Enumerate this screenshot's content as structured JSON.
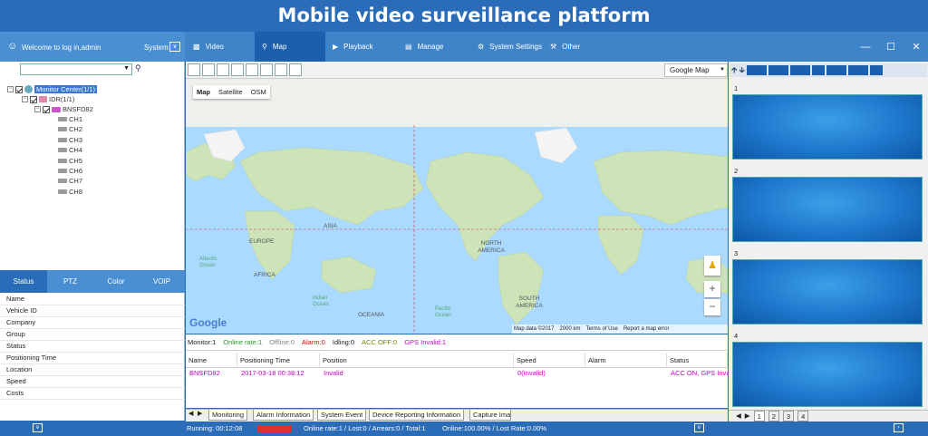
{
  "app": {
    "title": "Mobile video surveillance platform"
  },
  "user": {
    "welcome": "Welcome to log in,admin",
    "system_label": "System"
  },
  "nav": [
    {
      "label": "Video",
      "icon": "video-icon"
    },
    {
      "label": "Map",
      "icon": "map-pin-icon"
    },
    {
      "label": "Playback",
      "icon": "playback-icon"
    },
    {
      "label": "Manage",
      "icon": "document-icon"
    },
    {
      "label": "System Settings",
      "icon": "gear-icon"
    },
    {
      "label": "Other",
      "icon": "wrench-icon"
    }
  ],
  "search": {
    "value": ""
  },
  "tree": {
    "root": "Monitor Center(1/1)",
    "group": "IDR(1/1)",
    "device": "BNSFD82",
    "channels": [
      "CH1",
      "CH2",
      "CH3",
      "CH4",
      "CH5",
      "CH6",
      "CH7",
      "CH8"
    ]
  },
  "status_tabs": [
    "Status",
    "PTZ",
    "Color",
    "VOIP"
  ],
  "info_fields": [
    "Name",
    "Vehicle ID",
    "Company",
    "Group",
    "Status",
    "Positioning Time",
    "Location",
    "Speed",
    "Costs"
  ],
  "map": {
    "provider": "Google Map",
    "types": [
      "Map",
      "Satellite",
      "OSM"
    ],
    "labels": {
      "asia": "ASIA",
      "europe": "EUROPE",
      "africa": "AFRICA",
      "north_america": "NORTH AMERICA",
      "south_america": "SOUTH AMERICA",
      "oceania": "OCEANIA",
      "indian_ocean": "Indian Ocean",
      "pacific_ocean": "Pacific Ocean",
      "atlantic_ocean": "Atlantic Ocean"
    },
    "footer": {
      "logo": "Google",
      "data": "Map data ©2017",
      "scale": "2000 km",
      "terms": "Terms of Use",
      "report": "Report a map error"
    },
    "zoom_in": "+",
    "zoom_out": "−"
  },
  "monitor": {
    "monitor": "Monitor:1",
    "online": "Online rate:1",
    "offline": "Offline:0",
    "alarm": "Alarm:0",
    "idling": "Idling:0",
    "acc_off": "ACC OFF:0",
    "gps_invalid": "GPS Invalid:1"
  },
  "table": {
    "headers": [
      "Name",
      "Positioning Time",
      "Position",
      "Speed",
      "Alarm",
      "Status"
    ],
    "rows": [
      [
        "BNSFD82",
        "2017-03-18 00:38:12",
        "Invalid",
        "0(Invalid)",
        "",
        "ACC ON, GPS Invalid"
      ]
    ]
  },
  "bottom_tabs": [
    "Monitoring",
    "Alarm Information",
    "System Event",
    "Device Reporting Information",
    "Capture Ima"
  ],
  "video": {
    "slots": [
      "1",
      "2",
      "3",
      "4"
    ],
    "pages": [
      "1",
      "2",
      "3",
      "4"
    ]
  },
  "statusbar": {
    "running": "Running: 00:12:08",
    "stats": "Online rate:1 / Lost:0 / Arrears:0 / Total:1",
    "rates": "Online:100.00% / Lost Rate:0.00%"
  },
  "colors": {
    "title_bg": "#2a6cb8",
    "nav_active": "#1c5fae",
    "alarm": "#e00000",
    "online": "#2a9a2a",
    "magenta": "#c800c8"
  }
}
